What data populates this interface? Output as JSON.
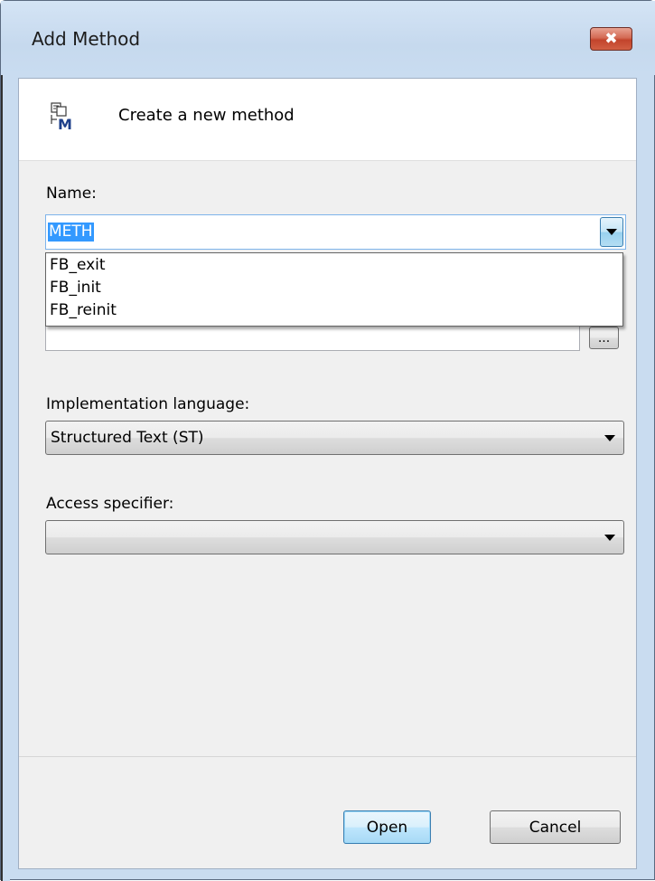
{
  "window": {
    "title": "Add Method",
    "close_glyph": "✖"
  },
  "header": {
    "icon": "method-icon",
    "text": "Create a new method"
  },
  "name_field": {
    "label": "Name:",
    "value": "METH",
    "options": [
      "FB_exit",
      "FB_init",
      "FB_reinit"
    ]
  },
  "hidden_field": {
    "browse_label": "..."
  },
  "implementation": {
    "label": "Implementation language:",
    "value": "Structured Text (ST)"
  },
  "access": {
    "label": "Access specifier:",
    "value": ""
  },
  "buttons": {
    "open": "Open",
    "cancel": "Cancel"
  },
  "colors": {
    "selection": "#3399ff",
    "close_button": "#c2442c",
    "frame": "#c9dcf0"
  }
}
